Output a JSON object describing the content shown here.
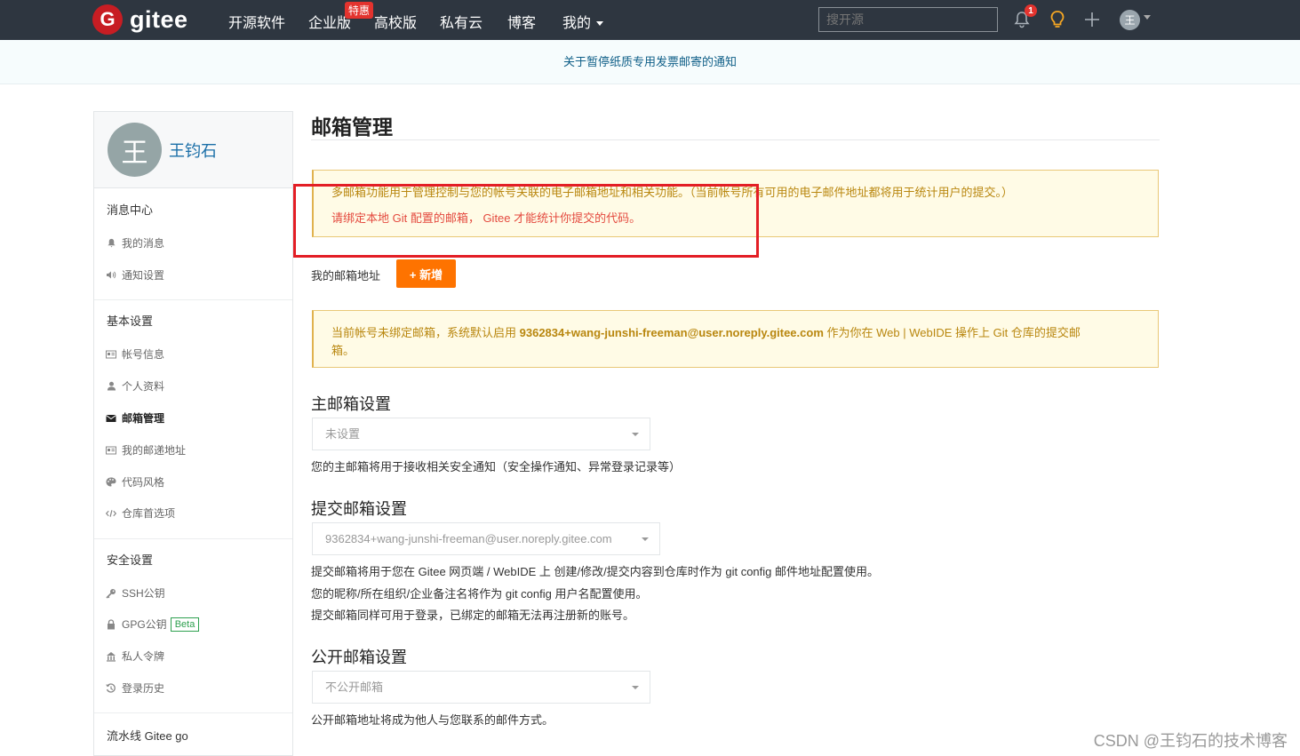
{
  "nav": {
    "logo_letter": "G",
    "logo_text": "gitee",
    "items": [
      "开源软件",
      "企业版",
      "高校版",
      "私有云",
      "博客",
      "我的"
    ],
    "enterprise_badge": "特惠",
    "search_placeholder": "搜开源",
    "notify_count": "1",
    "avatar_letter": "王"
  },
  "announcement": "关于暂停纸质专用发票邮寄的通知",
  "sidebar": {
    "avatar_letter": "王",
    "user_name": "王钧石",
    "sections": {
      "messages": "消息中心",
      "basic": "基本设置",
      "security": "安全设置",
      "pipeline": "流水线 Gitee go"
    },
    "items": {
      "my_messages": "我的消息",
      "notify_settings": "通知设置",
      "account_info": "帐号信息",
      "profile": "个人资料",
      "email_manage": "邮箱管理",
      "my_mail_address": "我的邮递地址",
      "code_style": "代码风格",
      "repo_prefs": "仓库首选项",
      "ssh_keys": "SSH公钥",
      "gpg_keys": "GPG公钥",
      "gpg_beta": "Beta",
      "private_tokens": "私人令牌",
      "login_history": "登录历史"
    }
  },
  "main": {
    "title": "邮箱管理",
    "notice1_line1": "多邮箱功能用于管理控制与您的帐号关联的电子邮箱地址和相关功能。（当前帐号所有可用的电子邮件地址都将用于统计用户的提交。）",
    "notice1_line2": "请绑定本地 Git 配置的邮箱， Gitee 才能统计你提交的代码。",
    "my_emails_label": "我的邮箱地址",
    "add_button": "+ 新增",
    "notice2_prefix": "当前帐号未绑定邮箱，系统默认启用 ",
    "notice2_email": "9362834+wang-junshi-freeman@user.noreply.gitee.com",
    "notice2_suffix": " 作为你在 Web | WebIDE 操作上 Git 仓库的提交邮",
    "notice2_line2": "箱。",
    "primary": {
      "title": "主邮箱设置",
      "value": "未设置",
      "help": "您的主邮箱将用于接收相关安全通知（安全操作通知、异常登录记录等）"
    },
    "commit": {
      "title": "提交邮箱设置",
      "value": "9362834+wang-junshi-freeman@user.noreply.gitee.com",
      "help1": "提交邮箱将用于您在 Gitee 网页端 / WebIDE 上 创建/修改/提交内容到仓库时作为 git config 邮件地址配置使用。",
      "help2": "您的昵称/所在组织/企业备注名将作为 git config 用户名配置使用。",
      "help3": "提交邮箱同样可用于登录，已绑定的邮箱无法再注册新的账号。"
    },
    "public": {
      "title": "公开邮箱设置",
      "value": "不公开邮箱",
      "help": "公开邮箱地址将成为他人与您联系的邮件方式。"
    }
  },
  "watermark": "CSDN @王钧石的技术博客",
  "colors": {
    "nav_bg": "#2e3640",
    "brand_red": "#c71d23",
    "accent_orange": "#fe7300",
    "link_blue": "#1b6fa8"
  }
}
